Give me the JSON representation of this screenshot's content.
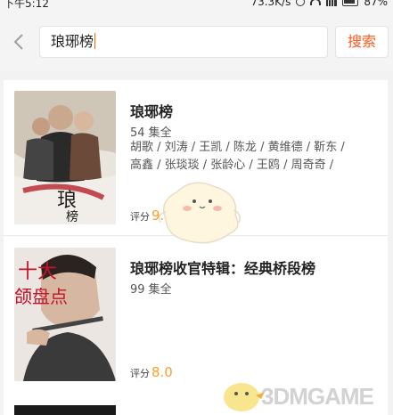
{
  "status_bar": {
    "time": "下午5:12",
    "speed": "73.3K/s",
    "battery": "87%"
  },
  "search": {
    "back_icon": "chevron-left-icon",
    "query": "琅琊榜",
    "button_label": "搜索"
  },
  "results": [
    {
      "title": "琅琊榜",
      "episodes": "54 集全",
      "cast_line1": "胡歌 / 刘涛 / 王凯 / 陈龙 / 黄维德 / 靳东 /",
      "cast_line2": "高鑫 / 张琰琰 / 张龄心 / 王鸥 / 周奇奇 /",
      "rating_label": "评分",
      "score": "9.8",
      "poster_text": "琅琊榜"
    },
    {
      "title": "琅琊榜收官特辑：经典桥段榜",
      "episodes": "99 集全",
      "rating_label": "评分",
      "score": "8.0",
      "poster_text": "十大 颌盘点"
    }
  ],
  "watermark": "3DMGAME",
  "colors": {
    "accent": "#ff5a1f",
    "score": "#ff9c2a"
  }
}
